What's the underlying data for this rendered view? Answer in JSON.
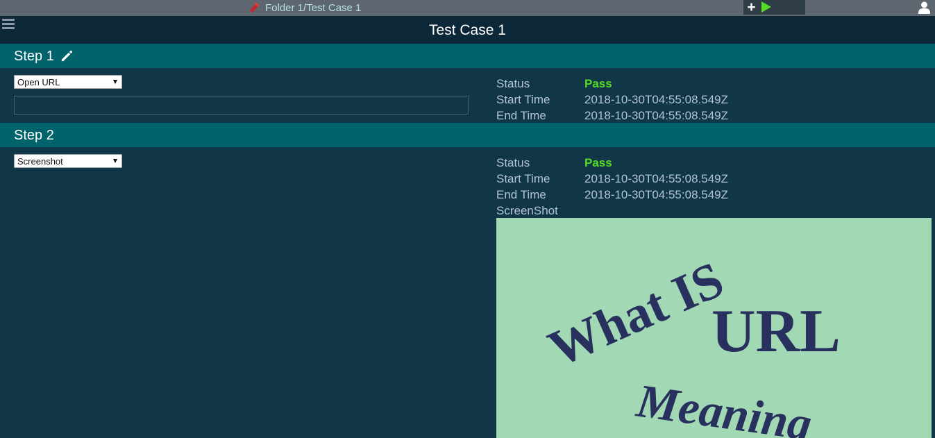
{
  "topbar": {
    "breadcrumb": "Folder 1/Test Case 1",
    "icons": [
      "test-tube-icon",
      "plus-icon",
      "play-icon",
      "user-icon"
    ]
  },
  "title": "Test Case 1",
  "steps": [
    {
      "title": "Step 1",
      "action": "Open URL",
      "url_value": "",
      "status_label": "Status",
      "status": "Pass",
      "start_label": "Start Time",
      "start_time": "2018-10-30T04:55:08.549Z",
      "end_label": "End Time",
      "end_time": "2018-10-30T04:55:08.549Z"
    },
    {
      "title": "Step 2",
      "action": "Screenshot",
      "status_label": "Status",
      "status": "Pass",
      "start_label": "Start Time",
      "start_time": "2018-10-30T04:55:08.549Z",
      "end_label": "End Time",
      "end_time": "2018-10-30T04:55:08.549Z",
      "screenshot_label": "ScreenShot",
      "screenshot_text": [
        "What IS",
        "URL",
        "Meaning"
      ]
    }
  ],
  "colors": {
    "background": "#113647",
    "step_header": "#00636b",
    "pass": "#55dd22",
    "screenshot_bg": "#a2d8b4",
    "screenshot_text": "#28305e"
  }
}
